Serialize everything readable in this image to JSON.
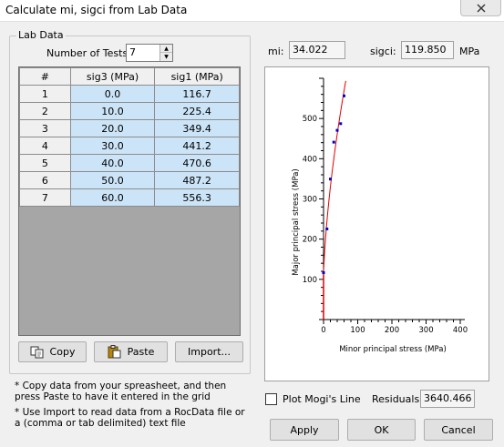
{
  "window": {
    "title": "Calculate mi, sigci from Lab Data"
  },
  "lab_data": {
    "group_label": "Lab Data",
    "num_tests_label": "Number of Tests:",
    "num_tests_value": "7",
    "columns": [
      "#",
      "sig3 (MPa)",
      "sig1 (MPa)"
    ],
    "rows": [
      [
        "1",
        "0.0",
        "116.7"
      ],
      [
        "2",
        "10.0",
        "225.4"
      ],
      [
        "3",
        "20.0",
        "349.4"
      ],
      [
        "4",
        "30.0",
        "441.2"
      ],
      [
        "5",
        "40.0",
        "470.6"
      ],
      [
        "6",
        "50.0",
        "487.2"
      ],
      [
        "7",
        "60.0",
        "556.3"
      ]
    ],
    "copy_label": "Copy",
    "paste_label": "Paste",
    "import_label": "Import...",
    "note1": "* Copy data from your spreasheet, and then press Paste to have it entered in the grid",
    "note2": "* Use Import to read data from a RocData file or a (comma or tab delimited) text file"
  },
  "results": {
    "mi_label": "mi:",
    "mi_value": "34.022",
    "sigci_label": "sigci:",
    "sigci_value": "119.850",
    "unit": "MPa"
  },
  "chart_data": {
    "type": "scatter",
    "xlabel": "Minor principal stress (MPa)",
    "ylabel": "Major principal stress (MPa)",
    "xlim": [
      0,
      400
    ],
    "ylim": [
      0,
      600
    ],
    "x_ticks": [
      "0",
      "100",
      "200",
      "300",
      "400"
    ],
    "y_ticks": [
      "100",
      "200",
      "300",
      "400",
      "500"
    ],
    "points": {
      "x": [
        0,
        10,
        20,
        30,
        40,
        50,
        60
      ],
      "y": [
        116.7,
        225.4,
        349.4,
        441.2,
        470.6,
        487.2,
        556.3
      ]
    },
    "point_color": "#0000c8",
    "fit_color": "#e00000",
    "fit": {
      "mi": 34.022,
      "sigci": 119.85,
      "x_max": 65
    }
  },
  "footer": {
    "mogi_label": "Plot Mogi's Line",
    "mogi_checked": false,
    "residuals_label": "Residuals:",
    "residuals_value": "3640.466",
    "apply_label": "Apply",
    "ok_label": "OK",
    "cancel_label": "Cancel"
  }
}
